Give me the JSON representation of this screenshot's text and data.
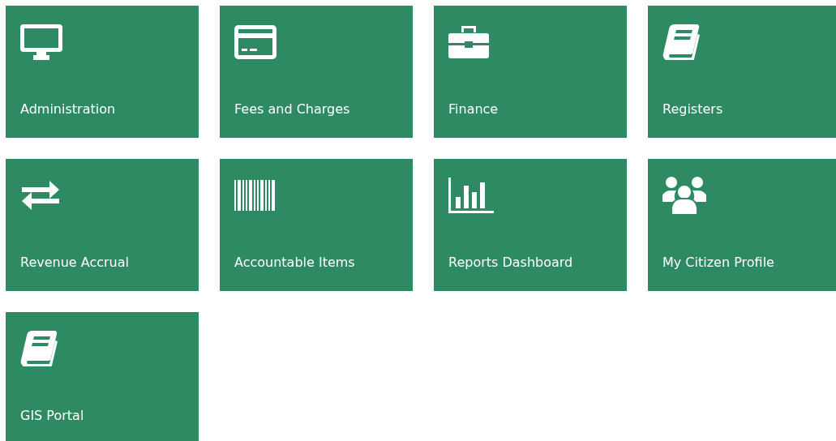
{
  "tiles": [
    {
      "label": "Administration",
      "kind": "monitor"
    },
    {
      "label": "Fees and Charges",
      "kind": "card"
    },
    {
      "label": "Finance",
      "kind": "briefcase"
    },
    {
      "label": "Registers",
      "kind": "book"
    },
    {
      "label": "Revenue Accrual",
      "kind": "exchange"
    },
    {
      "label": "Accountable Items",
      "kind": "barcode"
    },
    {
      "label": "Reports Dashboard",
      "kind": "chart"
    },
    {
      "label": "My Citizen Profile",
      "kind": "users"
    },
    {
      "label": "GIS Portal",
      "kind": "book"
    }
  ]
}
